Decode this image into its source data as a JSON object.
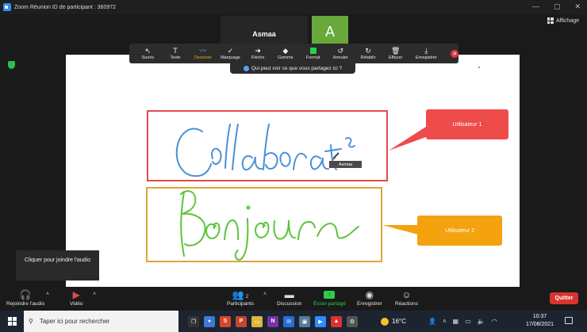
{
  "window": {
    "title": "Zoom Réunion ID de participant : 360972",
    "view_label": "Affichage"
  },
  "participants_tiles": {
    "name": "Asmaa",
    "avatar_letter": "A"
  },
  "annotation_toolbar": {
    "tools": [
      {
        "name": "mouse",
        "label": "Souris",
        "icon": "cursor-icon",
        "glyph": "↖"
      },
      {
        "name": "text",
        "label": "Texte",
        "icon": "text-icon",
        "glyph": "T"
      },
      {
        "name": "draw",
        "label": "Dessiner",
        "icon": "pen-icon",
        "glyph": "〰",
        "active": true
      },
      {
        "name": "stamp",
        "label": "Marquage",
        "icon": "checkmark-icon",
        "glyph": "✓"
      },
      {
        "name": "arrow",
        "label": "Flèche",
        "icon": "arrow-icon",
        "glyph": "➜"
      },
      {
        "name": "eraser",
        "label": "Gomme",
        "icon": "eraser-icon",
        "glyph": "◆"
      },
      {
        "name": "format",
        "label": "Format",
        "icon": "color-swatch-icon",
        "glyph": ""
      },
      {
        "name": "undo",
        "label": "Annuler",
        "icon": "undo-icon",
        "glyph": "↺"
      },
      {
        "name": "redo",
        "label": "Rétablir",
        "icon": "redo-icon",
        "glyph": "↻"
      },
      {
        "name": "clear",
        "label": "Effacer",
        "icon": "trash-icon",
        "glyph": "🗑"
      },
      {
        "name": "save",
        "label": "Enregistrer",
        "icon": "save-icon",
        "glyph": "⤓"
      }
    ],
    "who_can_see": "Qui peut voir ce que vous partagez ici ?"
  },
  "canvas": {
    "callout_red": "Utilisateur 1",
    "callout_orange": "Utilisateur 2",
    "cursor_label": "Asmaa",
    "colors": {
      "red": "#e34a4a",
      "orange": "#f5a20f",
      "blue_ink": "#4a90d9",
      "green_ink": "#5cc43a"
    }
  },
  "tooltip": "Cliquer pour joindre l'audio",
  "controls": {
    "join_audio": "Rejoindre l'audio",
    "video": "Vidéo",
    "participants": "Participants",
    "participants_count": "2",
    "chat": "Discussion",
    "share": "Écran partagé",
    "record": "Enregistrer",
    "reactions": "Réactions",
    "quit": "Quitter"
  },
  "taskbar": {
    "search_placeholder": "Taper ici pour rechercher",
    "temperature": "16°C",
    "time": "10:37",
    "date": "17/08/2021"
  }
}
